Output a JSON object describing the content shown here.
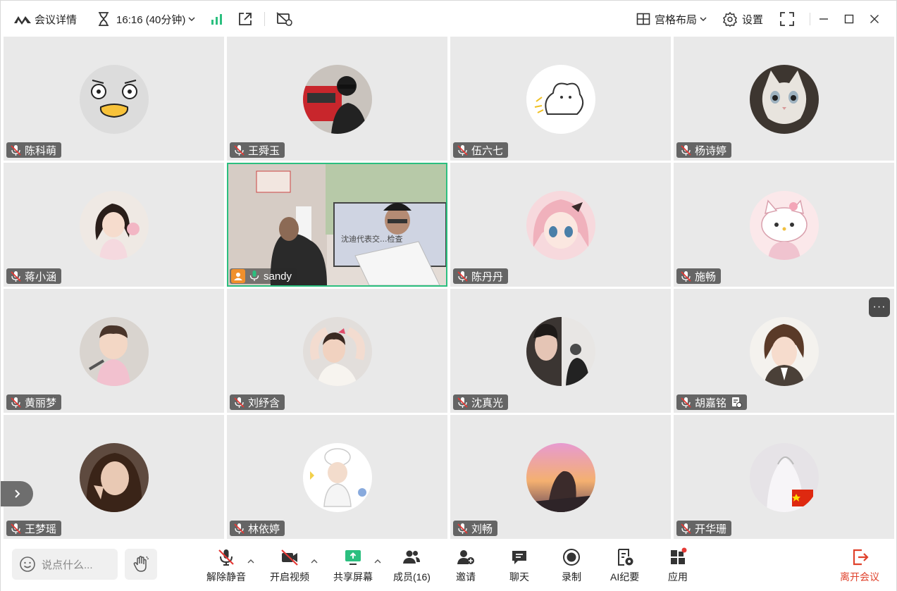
{
  "titlebar": {
    "meeting_detail": "会议详情",
    "time": "16:16 (40分钟)",
    "layout": "宫格布局",
    "settings": "设置"
  },
  "participants": [
    {
      "name": "陈科萌",
      "avatar": "duck-avatar"
    },
    {
      "name": "王舜玉",
      "avatar": "person-avatar"
    },
    {
      "name": "伍六七",
      "avatar": "cartoon-avatar"
    },
    {
      "name": "杨诗婷",
      "avatar": "cat-avatar"
    },
    {
      "name": "蒋小涵",
      "avatar": "girl-avatar"
    },
    {
      "name": "sandy",
      "avatar": "video-feed"
    },
    {
      "name": "陈丹丹",
      "avatar": "anime-avatar"
    },
    {
      "name": "施畅",
      "avatar": "kitty-avatar"
    },
    {
      "name": "黄丽梦",
      "avatar": "child-avatar"
    },
    {
      "name": "刘纾含",
      "avatar": "girl-avatar"
    },
    {
      "name": "沈真光",
      "avatar": "person-avatar"
    },
    {
      "name": "胡嘉铭",
      "avatar": "anime-avatar"
    },
    {
      "name": "王梦瑶",
      "avatar": "person-avatar"
    },
    {
      "name": "林依婷",
      "avatar": "chef-avatar"
    },
    {
      "name": "刘畅",
      "avatar": "sunset-avatar"
    },
    {
      "name": "开华珊",
      "avatar": "person-avatar"
    }
  ],
  "video_slide_text": "沈迪代表交...检查",
  "more_button": "···",
  "chat": {
    "placeholder": "说点什么..."
  },
  "toolbar": {
    "unmute": "解除静音",
    "start_video": "开启视频",
    "share_screen": "共享屏幕",
    "members": "成员(16)",
    "invite": "邀请",
    "chat": "聊天",
    "record": "录制",
    "ai_minutes": "AI纪要",
    "apps": "应用",
    "leave": "离开会议"
  },
  "colors": {
    "accent_green": "#2bbf7f",
    "leave_red": "#e0422c",
    "host_orange": "#f0902c",
    "tile_bg": "#e9e9e9"
  }
}
